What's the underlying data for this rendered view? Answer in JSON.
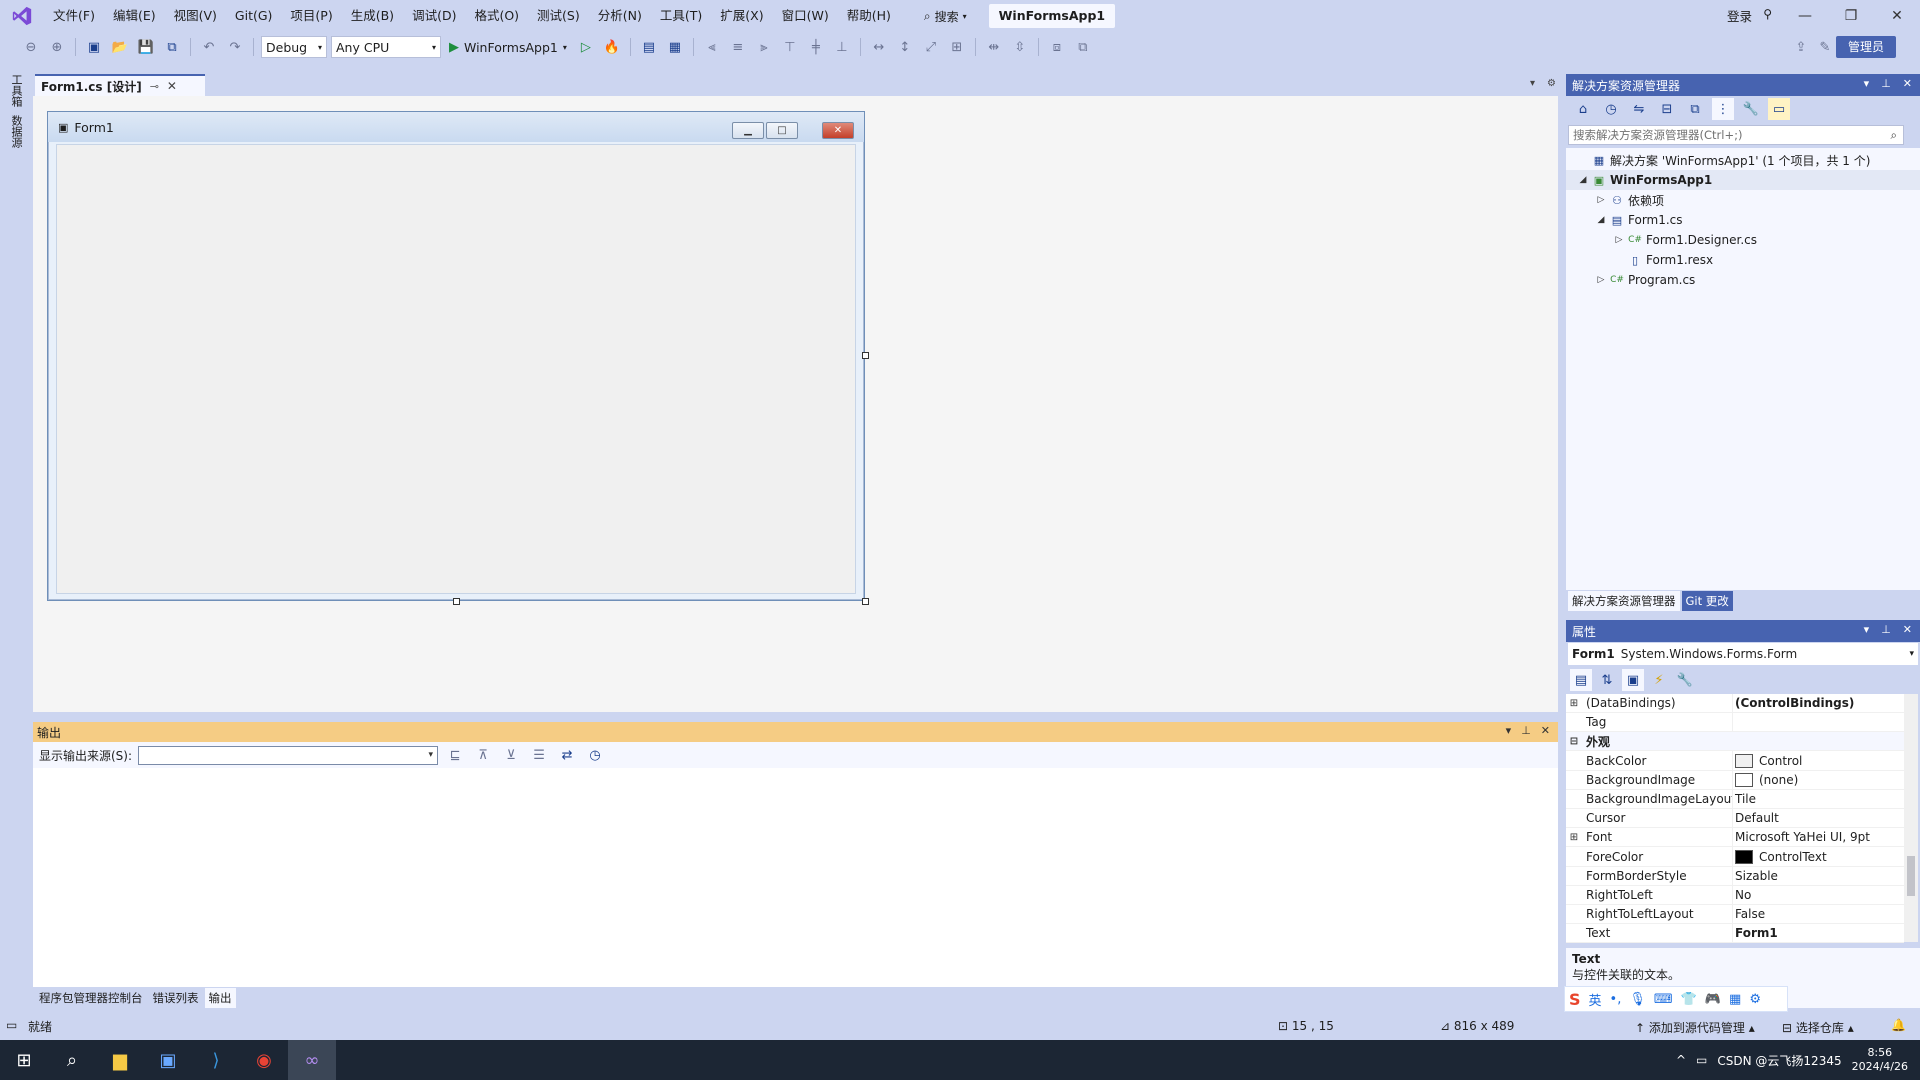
{
  "colors": {
    "accent": "#4763b0",
    "chrome": "#ccd5f0",
    "output_header": "#f5cc84",
    "run_green": "#1e8e3e"
  },
  "menu": [
    "文件(F)",
    "编辑(E)",
    "视图(V)",
    "Git(G)",
    "项目(P)",
    "生成(B)",
    "调试(D)",
    "格式(O)",
    "测试(S)",
    "分析(N)",
    "工具(T)",
    "扩展(X)",
    "窗口(W)",
    "帮助(H)"
  ],
  "search_label": "搜索",
  "solution_title": "WinFormsApp1",
  "login": "登录",
  "toolbar": {
    "config": "Debug",
    "platform": "Any CPU",
    "run_target": "WinFormsApp1",
    "admin_label": "管理员"
  },
  "left_strip": [
    "工具箱",
    "数据源"
  ],
  "doc_tab": {
    "title": "Form1.cs [设计]"
  },
  "form": {
    "title": "Form1"
  },
  "output": {
    "title": "输出",
    "source_label": "显示输出来源(S):",
    "source_value": ""
  },
  "bottom_tabs": [
    "程序包管理器控制台",
    "错误列表",
    "输出"
  ],
  "solution_explorer": {
    "title": "解决方案资源管理器",
    "search_placeholder": "搜索解决方案资源管理器(Ctrl+;)",
    "tree": [
      {
        "label": "解决方案 'WinFormsApp1' (1 个项目，共 1 个)",
        "icon": "solution-icon",
        "depth": 0,
        "expander": "",
        "bold": false
      },
      {
        "label": "WinFormsApp1",
        "icon": "csharp-project-icon",
        "depth": 0,
        "expander": "expanded",
        "bold": true
      },
      {
        "label": "依赖项",
        "icon": "dependencies-icon",
        "depth": 1,
        "expander": "collapsed",
        "bold": false
      },
      {
        "label": "Form1.cs",
        "icon": "form-icon",
        "depth": 1,
        "expander": "expanded",
        "bold": false
      },
      {
        "label": "Form1.Designer.cs",
        "icon": "csharp-file-icon",
        "depth": 2,
        "expander": "collapsed",
        "bold": false
      },
      {
        "label": "Form1.resx",
        "icon": "resx-file-icon",
        "depth": 2,
        "expander": "",
        "bold": false
      },
      {
        "label": "Program.cs",
        "icon": "csharp-file-icon",
        "depth": 1,
        "expander": "collapsed",
        "bold": false
      }
    ],
    "tabs": [
      "解决方案资源管理器",
      "Git 更改"
    ]
  },
  "properties": {
    "title": "属性",
    "object_name": "Form1",
    "object_type": "System.Windows.Forms.Form",
    "rows": [
      {
        "name": "(DataBindings)",
        "value": "(ControlBindings)",
        "expander": "plus",
        "category": false,
        "bold_value": true,
        "swatch": ""
      },
      {
        "name": "Tag",
        "value": "",
        "expander": "",
        "category": false,
        "bold_value": false,
        "swatch": ""
      },
      {
        "name": "外观",
        "value": "",
        "expander": "minus",
        "category": true,
        "bold_value": false,
        "swatch": ""
      },
      {
        "name": "BackColor",
        "value": "Control",
        "expander": "",
        "category": false,
        "bold_value": false,
        "swatch": "#f0f0f0"
      },
      {
        "name": "BackgroundImage",
        "value": "(none)",
        "expander": "",
        "category": false,
        "bold_value": false,
        "swatch": "#ffffff"
      },
      {
        "name": "BackgroundImageLayout",
        "value": "Tile",
        "expander": "",
        "category": false,
        "bold_value": false,
        "swatch": ""
      },
      {
        "name": "Cursor",
        "value": "Default",
        "expander": "",
        "category": false,
        "bold_value": false,
        "swatch": ""
      },
      {
        "name": "Font",
        "value": "Microsoft YaHei UI, 9pt",
        "expander": "plus",
        "category": false,
        "bold_value": false,
        "swatch": ""
      },
      {
        "name": "ForeColor",
        "value": "ControlText",
        "expander": "",
        "category": false,
        "bold_value": false,
        "swatch": "#000000"
      },
      {
        "name": "FormBorderStyle",
        "value": "Sizable",
        "expander": "",
        "category": false,
        "bold_value": false,
        "swatch": ""
      },
      {
        "name": "RightToLeft",
        "value": "No",
        "expander": "",
        "category": false,
        "bold_value": false,
        "swatch": ""
      },
      {
        "name": "RightToLeftLayout",
        "value": "False",
        "expander": "",
        "category": false,
        "bold_value": false,
        "swatch": ""
      },
      {
        "name": "Text",
        "value": "Form1",
        "expander": "",
        "category": false,
        "bold_value": true,
        "swatch": ""
      }
    ],
    "desc_title": "Text",
    "desc_text": "与控件关联的文本。"
  },
  "ime": {
    "mode": "英"
  },
  "status": {
    "ready": "就绪",
    "position": "15 , 15",
    "size": "816 x 489",
    "add_source": "添加到源代码管理",
    "select_repo": "选择仓库"
  },
  "taskbar": {
    "apps": [
      "windows-start-icon",
      "search-icon",
      "file-explorer-icon",
      "app-icon",
      "vscode-icon",
      "chrome-icon",
      "visual-studio-icon"
    ],
    "tray_text": "CSDN @云飞扬12345",
    "time": "8:56",
    "date": "2024/4/26"
  }
}
